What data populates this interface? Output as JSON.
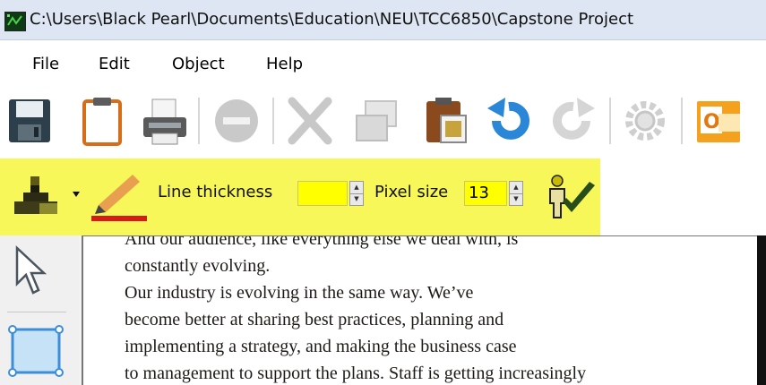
{
  "window": {
    "title": "C:\\Users\\Black Pearl\\Documents\\Education\\NEU\\TCC6850\\Capstone Project"
  },
  "menu": {
    "items": [
      "File",
      "Edit",
      "Object",
      "Help"
    ]
  },
  "toolbar": {
    "buttons": [
      "save-icon",
      "clipboard-icon",
      "print-icon",
      "minus-circle-icon",
      "cut-icon",
      "copy-icon",
      "paste-icon",
      "undo-icon",
      "redo-icon",
      "settings-gear-icon",
      "outlook-icon"
    ]
  },
  "tool_options": {
    "line_thickness_label": "Line thickness",
    "line_thickness_value": "",
    "pixel_size_label": "Pixel size",
    "pixel_size_value": "13",
    "highlight_color": "#f7f75a",
    "pencil_color": "#d61a1a"
  },
  "document": {
    "lines": [
      "And our audience, like everything else we deal with, is",
      "constantly evolving.",
      "   Our industry is evolving in the same way. We’ve",
      "become better at sharing best practices, planning and",
      "implementing a strategy, and making the business case",
      "to management to support the plans. Staff is getting increasingly"
    ]
  }
}
